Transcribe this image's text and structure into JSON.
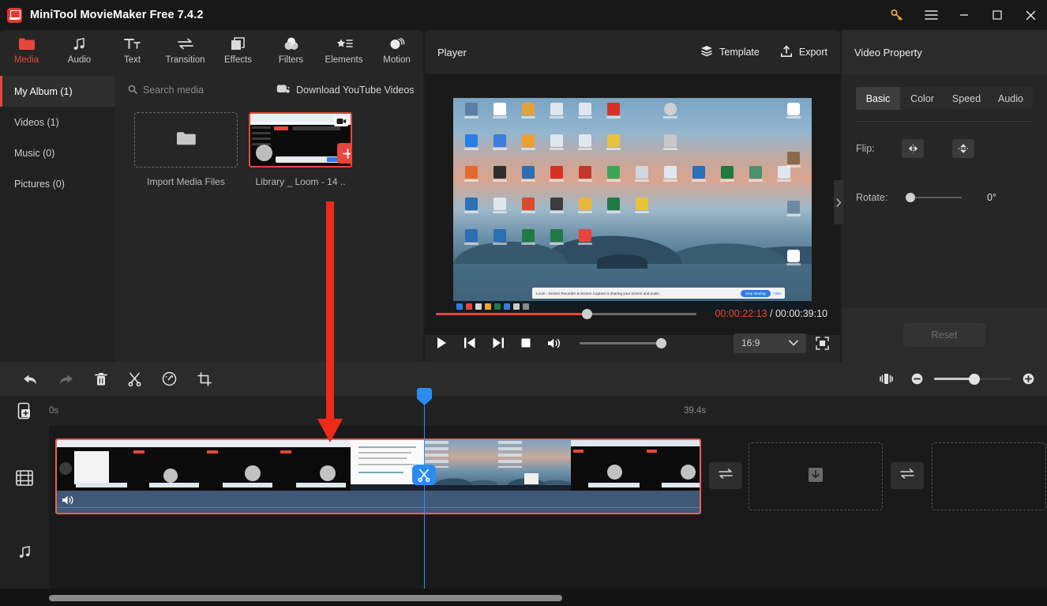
{
  "window": {
    "title": "MiniTool MovieMaker Free 7.4.2",
    "key_icon": "key-icon",
    "menu_icon": "hamburger-menu-icon",
    "minimize_icon": "minimize-icon",
    "maximize_icon": "maximize-icon",
    "close_icon": "close-icon"
  },
  "toolbar": {
    "tabs": [
      {
        "label": "Media",
        "icon": "folder-icon",
        "active": true
      },
      {
        "label": "Audio",
        "icon": "music-note-icon",
        "active": false
      },
      {
        "label": "Text",
        "icon": "text-icon",
        "active": false
      },
      {
        "label": "Transition",
        "icon": "transition-arrows-icon",
        "active": false
      },
      {
        "label": "Effects",
        "icon": "effects-layers-icon",
        "active": false
      },
      {
        "label": "Filters",
        "icon": "filters-circles-icon",
        "active": false
      },
      {
        "label": "Elements",
        "icon": "elements-star-list-icon",
        "active": false
      },
      {
        "label": "Motion",
        "icon": "motion-ball-icon",
        "active": false
      }
    ]
  },
  "media_panel": {
    "albums": [
      {
        "label": "My Album (1)",
        "selected": true
      },
      {
        "label": "Videos (1)",
        "selected": false
      },
      {
        "label": "Music (0)",
        "selected": false
      },
      {
        "label": "Pictures (0)",
        "selected": false
      }
    ],
    "search_placeholder": "Search media",
    "search_icon": "search-icon",
    "download_youtube_label": "Download YouTube Videos",
    "download_youtube_icon": "youtube-download-icon",
    "import_label": "Import Media Files",
    "import_icon": "folder-import-icon",
    "items": [
      {
        "caption": "Library _ Loom - 14 ..",
        "add_icon": "plus-icon",
        "badge_icon": "video-camera-icon"
      }
    ]
  },
  "player": {
    "title": "Player",
    "template_label": "Template",
    "template_icon": "layers-icon",
    "export_label": "Export",
    "export_icon": "export-upload-icon",
    "current_time": "00:00:22:13",
    "separator": "/",
    "total_time": "00:00:39:10",
    "progress_percent": 58,
    "controls": [
      {
        "name": "play-button",
        "icon": "play-icon"
      },
      {
        "name": "previous-frame-button",
        "icon": "skip-back-icon"
      },
      {
        "name": "next-frame-button",
        "icon": "skip-forward-icon"
      },
      {
        "name": "stop-button",
        "icon": "stop-icon"
      },
      {
        "name": "volume-button",
        "icon": "volume-icon"
      }
    ],
    "aspect_ratio": "16:9",
    "aspect_chevron": "chevron-down-icon",
    "fullscreen_icon": "fullscreen-icon",
    "preview_overlay_text": "Loom - Screen Recorder & Screen Capture is sharing your screen and audio.",
    "preview_overlay_button": "Stop sharing",
    "preview_overlay_link": "Hide"
  },
  "properties": {
    "title": "Video Property",
    "tabs": [
      {
        "label": "Basic",
        "active": true
      },
      {
        "label": "Color",
        "active": false
      },
      {
        "label": "Speed",
        "active": false
      },
      {
        "label": "Audio",
        "active": false
      }
    ],
    "flip_label": "Flip:",
    "flip_horizontal_icon": "flip-horizontal-icon",
    "flip_vertical_icon": "flip-vertical-icon",
    "rotate_label": "Rotate:",
    "rotate_value": "0°",
    "reset_label": "Reset",
    "collapse_icon": "chevron-right-icon"
  },
  "timeline": {
    "tools": [
      {
        "name": "undo-button",
        "icon": "undo-arrow-icon",
        "enabled": true
      },
      {
        "name": "redo-button",
        "icon": "redo-arrow-icon",
        "enabled": false
      },
      {
        "name": "delete-button",
        "icon": "trash-icon",
        "enabled": true
      },
      {
        "name": "split-button",
        "icon": "scissors-icon",
        "enabled": true
      },
      {
        "name": "speed-button",
        "icon": "speedometer-icon",
        "enabled": true
      },
      {
        "name": "crop-button",
        "icon": "crop-icon",
        "enabled": true
      }
    ],
    "fit_icon": "fit-timeline-icon",
    "zoom_out_icon": "zoom-out-icon",
    "zoom_in_icon": "zoom-in-icon",
    "zoom_percent": 52,
    "add_track_icon": "add-track-icon",
    "ruler_start": "0s",
    "ruler_end": "39.4s",
    "video_track_icon": "film-strip-icon",
    "audio_track_icon": "music-note-icon",
    "clip_audio_icon": "speaker-icon",
    "playhead_split_icon": "scissors-icon",
    "transition_slot_icon": "transition-arrows-icon",
    "drop_zone_icon": "download-box-icon"
  },
  "colors": {
    "accent_red": "#e8453c",
    "arrow_red": "#f02a18",
    "playhead_blue": "#2b8cf0",
    "clip_border": "#f06055",
    "panel_bg": "#262626",
    "window_bg": "#1e1e1e"
  }
}
